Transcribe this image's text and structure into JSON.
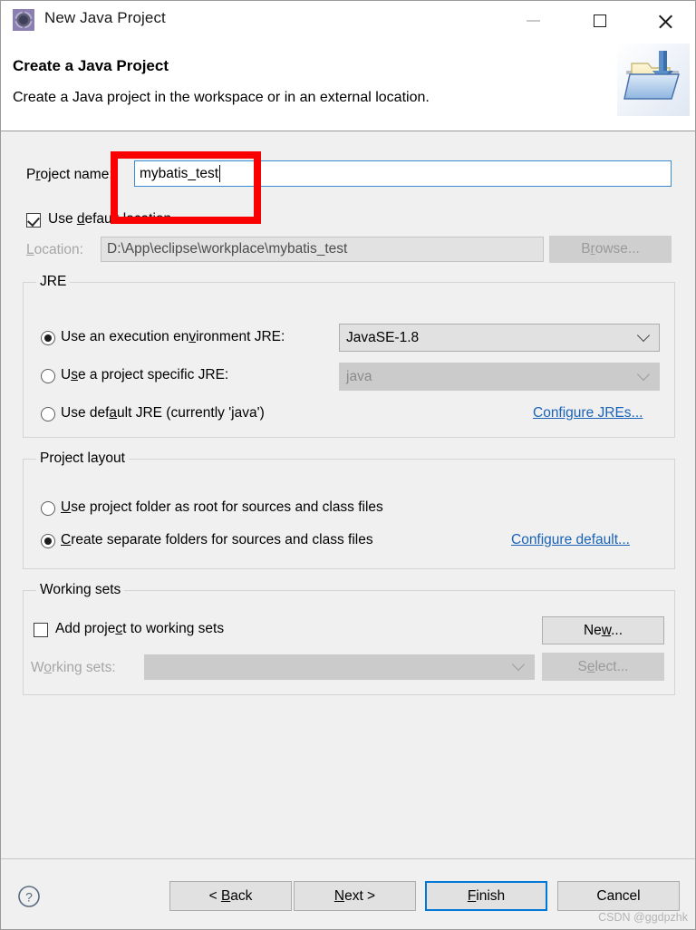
{
  "window": {
    "title": "New Java Project",
    "app_icon": "java-project-wizard-icon",
    "minimize_label": "Minimize",
    "maximize_label": "Maximize",
    "close_label": "Close"
  },
  "header": {
    "title": "Create a Java Project",
    "description": "Create a Java project in the workspace or in an external location.",
    "banner_icon": "open-folder-java-icon"
  },
  "form": {
    "project_name": {
      "label_pre": "P",
      "label_key": "r",
      "label_post": "oject name:",
      "value": "mybatis_test",
      "placeholder": ""
    },
    "use_default_location": {
      "label_pre": "Use ",
      "label_key": "d",
      "label_post": "efault location",
      "checked": true
    },
    "location": {
      "label_key": "L",
      "label_post": "ocation:",
      "value": "D:\\App\\eclipse\\workplace\\mybatis_test"
    },
    "browse_button": {
      "pre": "B",
      "key": "r",
      "post": "owse..."
    }
  },
  "jre": {
    "group_title": "JRE",
    "option_execution_env": {
      "pre": "Use an execution en",
      "key": "v",
      "post": "ironment JRE:",
      "selected": true
    },
    "execution_env_value": "JavaSE-1.8",
    "option_project_specific": {
      "pre": "U",
      "key": "s",
      "post": "e a project specific JRE:",
      "selected": false
    },
    "project_specific_value": "java",
    "option_default_jre": {
      "pre": "Use def",
      "key": "a",
      "post": "ult JRE (currently 'java')",
      "selected": false
    },
    "configure_link": "Configure JREs..."
  },
  "project_layout": {
    "group_title": "Project layout",
    "option_project_folder": {
      "pre": "",
      "key": "U",
      "post": "se project folder as root for sources and class files",
      "selected": false
    },
    "option_separate_folders": {
      "pre": "",
      "key": "C",
      "post": "reate separate folders for sources and class files",
      "selected": true
    },
    "configure_link": "Configure default..."
  },
  "working_sets": {
    "group_title": "Working sets",
    "add_to_working_sets": {
      "pre": "Add proje",
      "key": "c",
      "post": "t to working sets",
      "checked": false
    },
    "new_button": {
      "pre": "Ne",
      "key": "w",
      "post": "..."
    },
    "label": {
      "pre": "W",
      "key": "o",
      "post": "rking sets:"
    },
    "value": "",
    "select_button": {
      "pre": "S",
      "key": "e",
      "post": "lect..."
    }
  },
  "footer": {
    "help_icon": "help-question-icon",
    "back_button": {
      "pre": "< ",
      "key": "B",
      "post": "ack"
    },
    "next_button": {
      "pre": "",
      "key": "N",
      "post": "ext >"
    },
    "finish_button": {
      "pre": "",
      "key": "F",
      "post": "inish"
    },
    "cancel_button": {
      "pre": "",
      "key": "",
      "post": "Cancel"
    },
    "watermark": "CSDN @ggdpzhk"
  },
  "colors": {
    "accent_blue": "#0078d7",
    "link_blue": "#1a63b8",
    "annotation_red": "#fb0000",
    "dialog_bg": "#f0f0f0",
    "header_bg": "#ffffff"
  }
}
